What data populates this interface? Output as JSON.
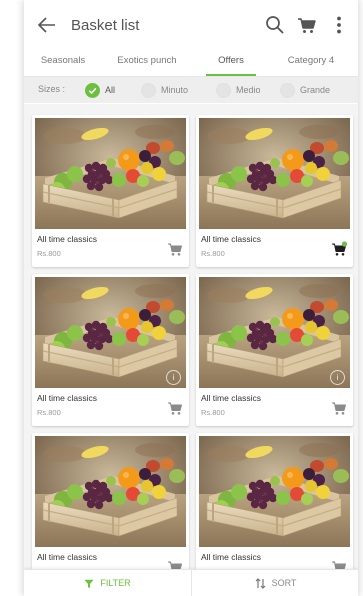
{
  "header": {
    "title": "Basket list",
    "icons": [
      "back-arrow-icon",
      "search-icon",
      "cart-icon",
      "more-vertical-icon"
    ]
  },
  "tabs": [
    {
      "label": "Seasonals",
      "active": false
    },
    {
      "label": "Exotics punch",
      "active": false
    },
    {
      "label": "Offers",
      "active": true
    },
    {
      "label": "Category 4",
      "active": false
    }
  ],
  "sizes": {
    "label": "Sizes :",
    "options": [
      {
        "label": "All",
        "selected": true
      },
      {
        "label": "Minuto",
        "selected": false
      },
      {
        "label": "Medio",
        "selected": false
      },
      {
        "label": "Grande",
        "selected": false
      }
    ]
  },
  "products": [
    {
      "name": "All time classics",
      "price": "Rs.800",
      "cart_active": false,
      "info_icon": false
    },
    {
      "name": "All time classics",
      "price": "Rs.800",
      "cart_active": true,
      "info_icon": false
    },
    {
      "name": "All time classics",
      "price": "Rs.800",
      "cart_active": false,
      "info_icon": true
    },
    {
      "name": "All time classics",
      "price": "Rs.800",
      "cart_active": false,
      "info_icon": true
    },
    {
      "name": "All time classics",
      "price": "",
      "cart_active": false,
      "info_icon": false
    },
    {
      "name": "All time classics",
      "price": "",
      "cart_active": false,
      "info_icon": false
    }
  ],
  "bottom_bar": {
    "filter_label": "FILTER",
    "sort_label": "SORT"
  },
  "colors": {
    "accent": "#6dbf3f",
    "icon_grey": "#888888",
    "cart_active": "#1f1f1f"
  }
}
